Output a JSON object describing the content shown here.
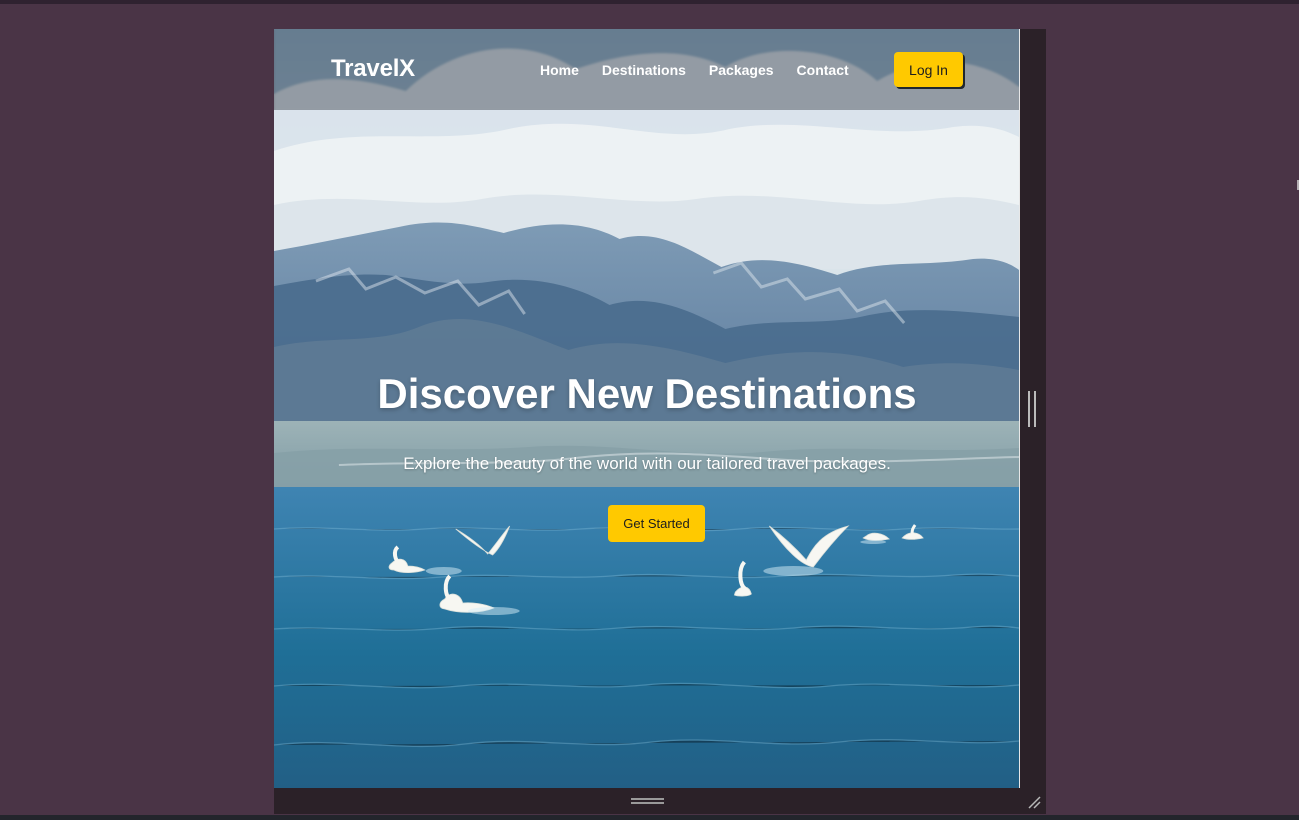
{
  "page": {
    "logo": "TravelX",
    "nav": [
      "Home",
      "Destinations",
      "Packages",
      "Contact"
    ],
    "login_label": "Log In",
    "hero": {
      "title": "Discover New Destinations",
      "subtitle": "Explore the beauty of the world with our tailored travel packages.",
      "cta_label": "Get Started"
    }
  },
  "icons": {
    "side_resize": "double-vertical-line-icon",
    "bottom_resize": "double-horizontal-line-icon",
    "corner_resize": "resize-corner-icon"
  },
  "colors": {
    "outer_background": "#4a3446",
    "device_frame": "#2b2128",
    "nav_overlay": "rgba(96,104,112,0.58)",
    "button_yellow": "#ffc900",
    "text_white": "#ffffff"
  }
}
